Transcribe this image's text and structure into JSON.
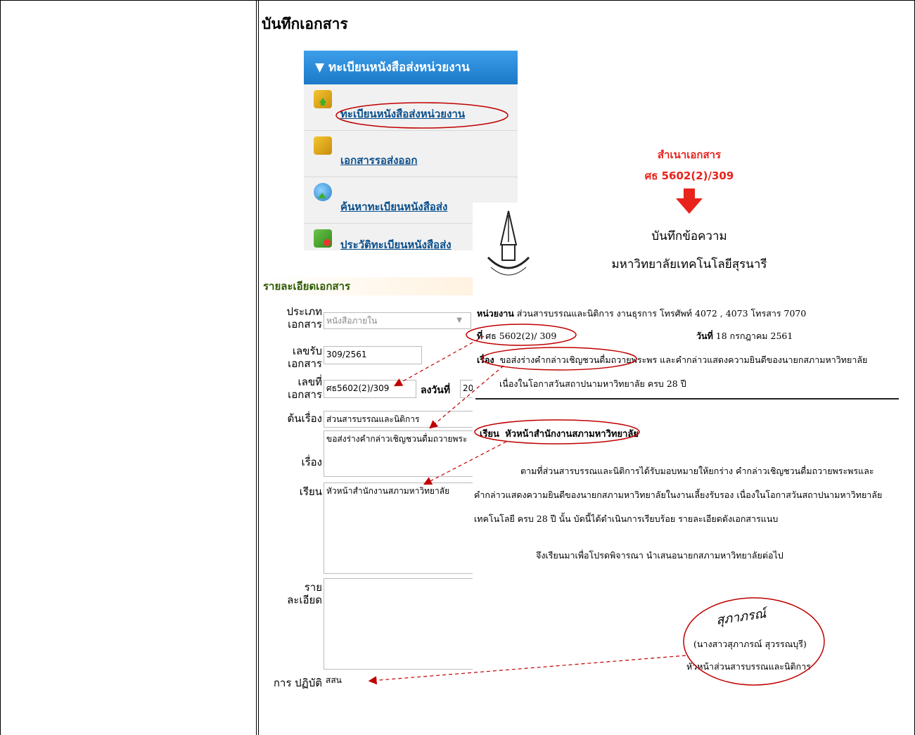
{
  "page": {
    "title": "บันทึกเอกสาร"
  },
  "menu": {
    "header": "▼ ทะเบียนหนังสือส่งหน่วยงาน",
    "items": [
      {
        "label": "ทะเบียนหนังสือส่งหน่วยงาน",
        "icon": "folder-home-icon"
      },
      {
        "label": "เอกสารรอส่งออก",
        "icon": "folder-icon"
      },
      {
        "label": "ค้นหาทะเบียนหนังสือส่ง",
        "icon": "search-globe-icon"
      },
      {
        "label": "ประวัติทะเบียนหนังสือส่ง",
        "icon": "history-icon"
      }
    ]
  },
  "form": {
    "title": "รายละเอียดเอกสาร",
    "doc_type_label": "ประเภท เอกสาร",
    "doc_type_value": "หนังสือภายใน",
    "receive_no_label": "เลขรับ เอกสาร",
    "receive_no_value": "309/2561",
    "doc_no_label": "เลขที่ เอกสาร",
    "doc_no_value": "ศธ5602(2)/309",
    "date_label": "ลงวันที่",
    "date_value": "20",
    "origin_label": "ต้นเรื่อง",
    "origin_value": "ส่วนสารบรรณและนิติการ",
    "subject_label": "เรื่อง",
    "subject_value": "ขอส่งร่างคำกล่าวเชิญชวนดื่มถวายพระ",
    "to_label": "เรียน",
    "to_value": "หัวหน้าสำนักงานสภามหาวิทยาลัย",
    "detail_label": "ราย ละเอียด",
    "detail_value": "",
    "action_label": "การ ปฏิบัติ",
    "action_value": "สสน"
  },
  "note": {
    "line1": "สำเนาเอกสาร",
    "line2": "ศธ 5602(2)/309"
  },
  "memo": {
    "heading": "บันทึกข้อความ",
    "university": "มหาวิทยาลัยเทคโนโลยีสุรนารี",
    "logo_text": "มหาวิทยาลัยเทคโนโลยีสุรนารี",
    "unit_label": "หน่วยงาน",
    "unit_value": "ส่วนสารบรรณและนิติการ  งานธุรการ  โทรศัพท์ 4072 , 4073  โทรสาร 7070",
    "ref_label": "ที่",
    "ref_value": "ศธ 5602(2)/ 309",
    "date_label": "วันที่",
    "date_value": "18  กรกฎาคม  2561",
    "subject_label": "เรื่อง",
    "subject_line1": "ขอส่งร่างคำกล่าวเชิญชวนดื่มถวายพระพร และคำกล่าวแสดงความยินดีของนายกสภามหาวิทยาลัย",
    "subject_line2": "เนื่องในโอกาสวันสถาปนามหาวิทยาลัย ครบ 28 ปี",
    "to_label": "เรียน",
    "to_value": "หัวหน้าสำนักงานสภามหาวิทยาลัย",
    "body1": "ตามที่ส่วนสารบรรณและนิติการได้รับมอบหมายให้ยกร่าง คำกล่าวเชิญชวนดื่มถวายพระพรและ",
    "body2": "คำกล่าวแสดงความยินดีของนายกสภามหาวิทยาลัยในงานเลี้ยงรับรอง เนื่องในโอกาสวันสถาปนามหาวิทยาลัย",
    "body3": "เทคโนโลยี ครบ 28 ปี นั้น  บัดนี้ได้ดำเนินการเรียบร้อย รายละเอียดดังเอกสารแนบ",
    "body4": "จึงเรียนมาเพื่อโปรดพิจารณา นำเสนอนายกสภามหาวิทยาลัยต่อไป",
    "signature": "สุภาภรณ์",
    "signer_name": "(นางสาวสุภาภรณ์  สุวรรณบุรี)",
    "signer_title": "หัวหน้าส่วนสารบรรณและนิติการ"
  },
  "colors": {
    "menu_header": "#1b79c7",
    "annotation": "#c00000",
    "note": "#e8231c",
    "link": "#0b4f8c"
  }
}
